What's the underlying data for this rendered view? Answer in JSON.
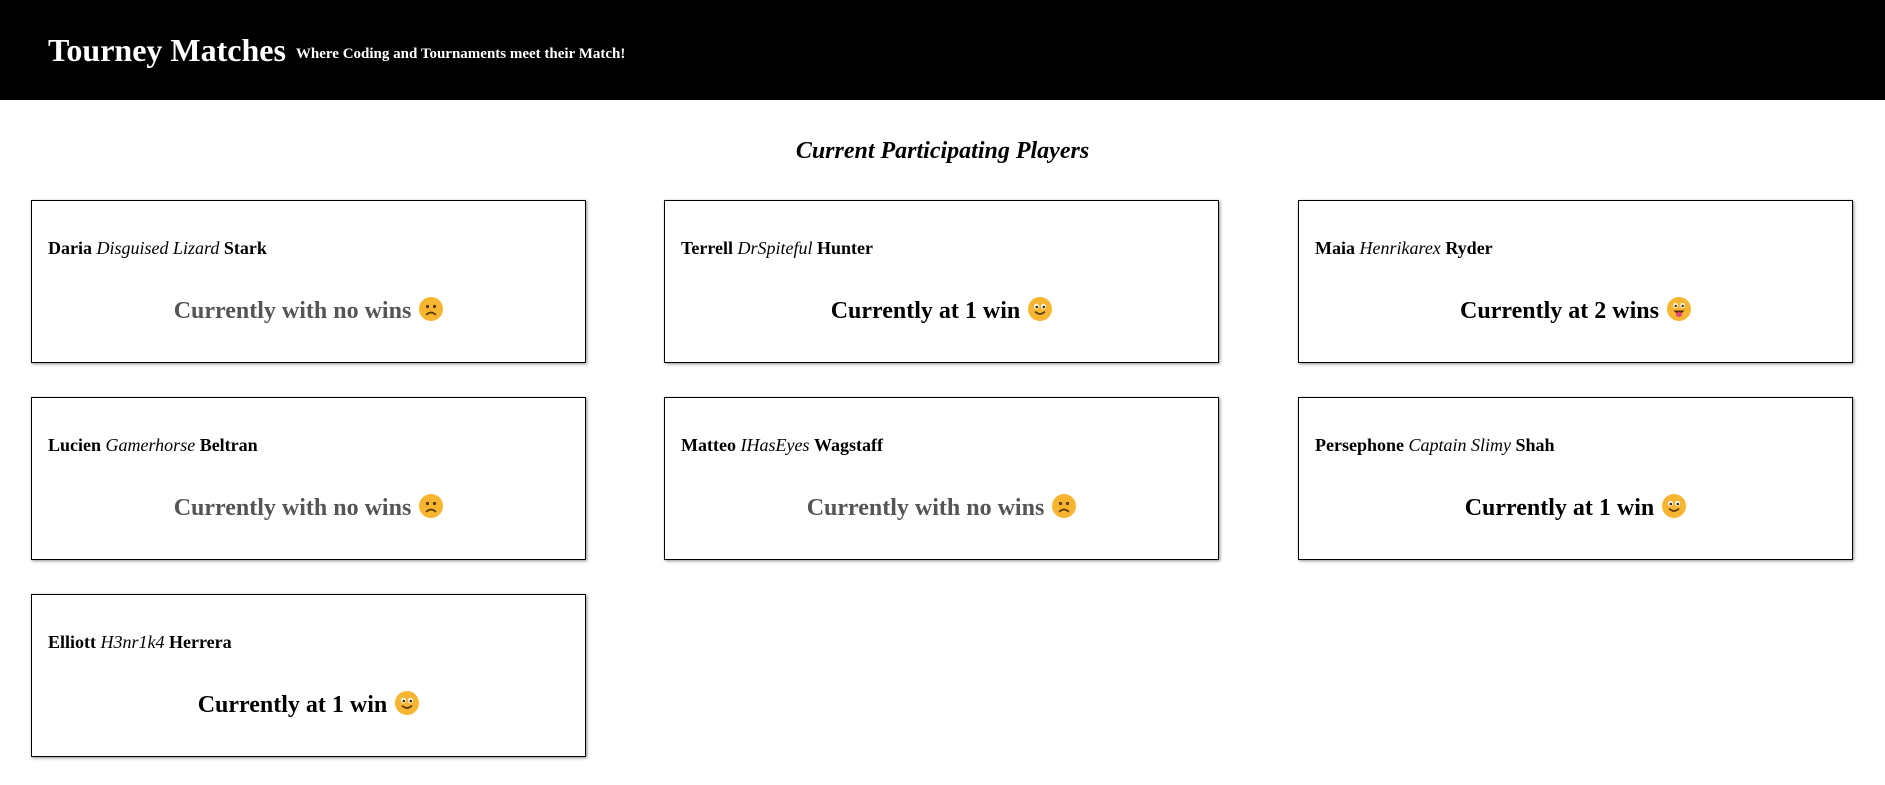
{
  "header": {
    "title": "Tourney Matches",
    "tagline": "Where Coding and Tournaments meet their Match!"
  },
  "section_title": "Current Participating Players",
  "players": [
    {
      "first": "Daria",
      "nick": "Disguised Lizard",
      "last": "Stark",
      "wins_text": "Currently with no wins",
      "wins": 0,
      "emoji": "frowning-face-icon"
    },
    {
      "first": "Terrell",
      "nick": "DrSpiteful",
      "last": "Hunter",
      "wins_text": "Currently at 1 win",
      "wins": 1,
      "emoji": "smiling-face-icon"
    },
    {
      "first": "Maia",
      "nick": "Henrikarex",
      "last": "Ryder",
      "wins_text": "Currently at 2 wins",
      "wins": 2,
      "emoji": "tongue-out-face-icon"
    },
    {
      "first": "Lucien",
      "nick": "Gamerhorse",
      "last": "Beltran",
      "wins_text": "Currently with no wins",
      "wins": 0,
      "emoji": "frowning-face-icon"
    },
    {
      "first": "Matteo",
      "nick": "IHasEyes",
      "last": "Wagstaff",
      "wins_text": "Currently with no wins",
      "wins": 0,
      "emoji": "frowning-face-icon"
    },
    {
      "first": "Persephone",
      "nick": "Captain Slimy",
      "last": "Shah",
      "wins_text": "Currently at 1 win",
      "wins": 1,
      "emoji": "smiling-face-icon"
    },
    {
      "first": "Elliott",
      "nick": "H3nr1k4",
      "last": "Herrera",
      "wins_text": "Currently at 1 win",
      "wins": 1,
      "emoji": "smiling-face-icon"
    }
  ],
  "colors": {
    "header_bg": "#000000",
    "header_text": "#ffffff",
    "no_wins_text": "#555555",
    "wins_text": "#000000",
    "emoji_yellow": "#f7b531"
  }
}
